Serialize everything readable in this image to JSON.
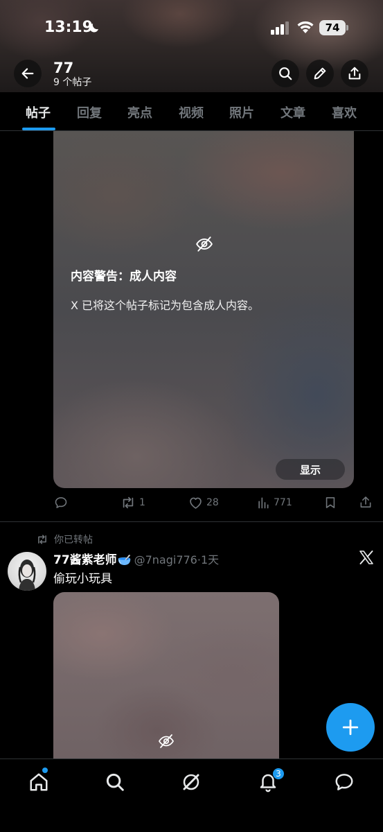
{
  "status_bar": {
    "time": "13:19",
    "battery": "74"
  },
  "header": {
    "name": "77",
    "post_count": "9 个帖子"
  },
  "tabs": [
    {
      "label": "帖子",
      "active": true
    },
    {
      "label": "回复"
    },
    {
      "label": "亮点"
    },
    {
      "label": "视频"
    },
    {
      "label": "照片"
    },
    {
      "label": "文章"
    },
    {
      "label": "喜欢"
    }
  ],
  "post1": {
    "warning_title": "内容警告：成人内容",
    "warning_text": "X 已将这个帖子标记为包含成人内容。",
    "show_label": "显示",
    "replies": "",
    "reposts": "1",
    "likes": "28",
    "views": "771"
  },
  "post2": {
    "repost_label": "你已转帖",
    "author_name": "77酱紫老师",
    "author_handle": "@7nagi776",
    "time": "·1天",
    "text": "偷玩小玩具"
  },
  "bottom_nav": {
    "notifications_count": "3"
  },
  "colors": {
    "accent": "#1d9bf0",
    "muted": "#71767b",
    "text": "#e7e9ea",
    "divider": "#2f3336"
  }
}
